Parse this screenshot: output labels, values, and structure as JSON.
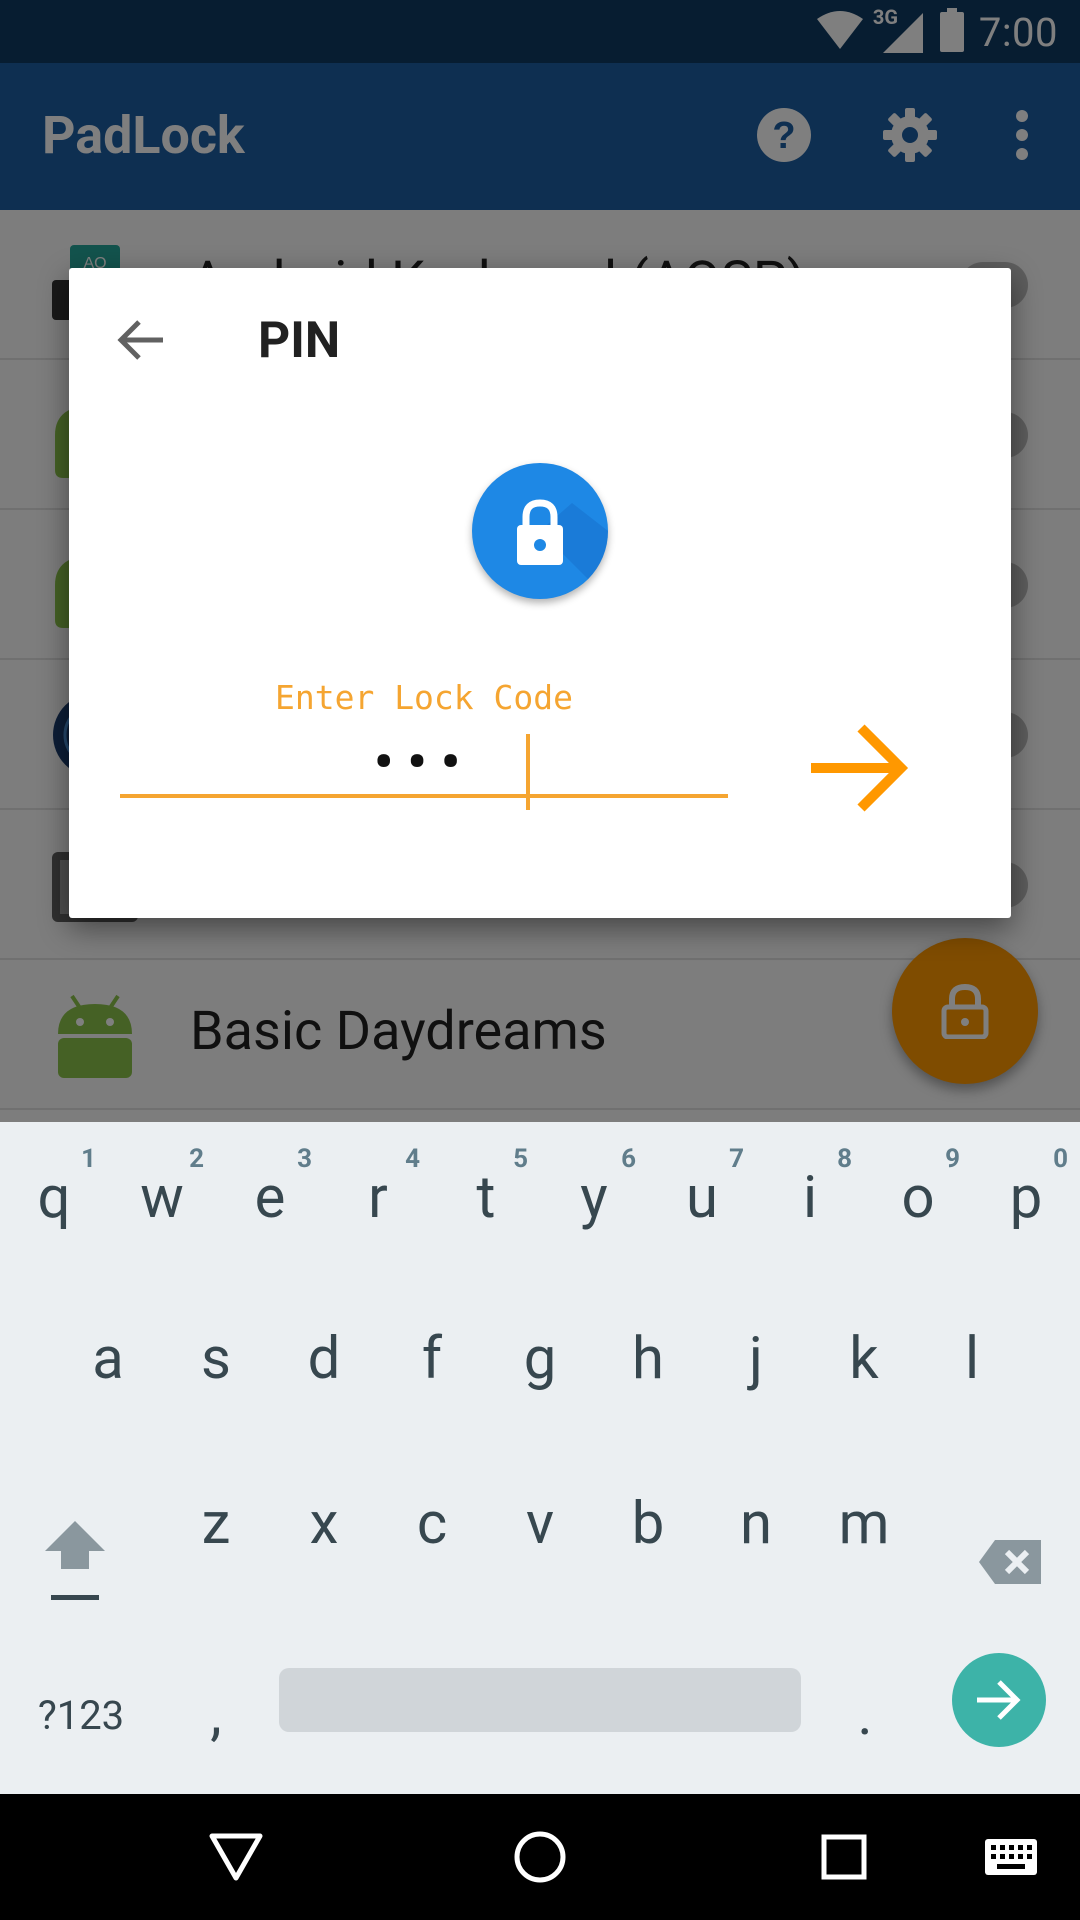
{
  "status_bar": {
    "time": "7:00",
    "network_label": "3G",
    "icons": [
      "wifi-icon",
      "cell-signal-icon",
      "battery-icon"
    ]
  },
  "app_bar": {
    "title": "PadLock",
    "actions": [
      "help-icon",
      "settings-gear-icon",
      "overflow-menu-icon"
    ]
  },
  "app_list": {
    "items": [
      {
        "label": "Android Keyboard (AOSP)",
        "icon": "aosp-keyboard-icon",
        "locked": false
      },
      {
        "label": "",
        "icon": "android-robot-icon",
        "locked": false
      },
      {
        "label": "",
        "icon": "android-robot-icon",
        "locked": false
      },
      {
        "label": "",
        "icon": "globe-app-icon",
        "locked": false
      },
      {
        "label": "",
        "icon": "device-app-icon",
        "locked": false
      },
      {
        "label": "Basic Daydreams",
        "icon": "android-robot-icon",
        "locked": false
      }
    ],
    "fab_icon": "lock-icon"
  },
  "dialog": {
    "title": "PIN",
    "back_icon": "back-arrow-icon",
    "lock_icon": "lock-icon",
    "field_label": "Enter Lock Code",
    "field_value": "•••",
    "submit_icon": "forward-arrow-icon",
    "accent": "#f5a531"
  },
  "keyboard": {
    "row1": [
      {
        "label": "q",
        "hint": "1"
      },
      {
        "label": "w",
        "hint": "2"
      },
      {
        "label": "e",
        "hint": "3"
      },
      {
        "label": "r",
        "hint": "4"
      },
      {
        "label": "t",
        "hint": "5"
      },
      {
        "label": "y",
        "hint": "6"
      },
      {
        "label": "u",
        "hint": "7"
      },
      {
        "label": "i",
        "hint": "8"
      },
      {
        "label": "o",
        "hint": "9"
      },
      {
        "label": "p",
        "hint": "0"
      }
    ],
    "row2": [
      "a",
      "s",
      "d",
      "f",
      "g",
      "h",
      "j",
      "k",
      "l"
    ],
    "row3": [
      "z",
      "x",
      "c",
      "v",
      "b",
      "n",
      "m"
    ],
    "symbols_label": "?123",
    "comma_label": ",",
    "period_label": ".",
    "enter_color": "#3db3a8"
  },
  "nav_bar": {
    "buttons": [
      "back-triangle-icon",
      "home-circle-icon",
      "recents-square-icon",
      "keyboard-switch-icon"
    ]
  }
}
